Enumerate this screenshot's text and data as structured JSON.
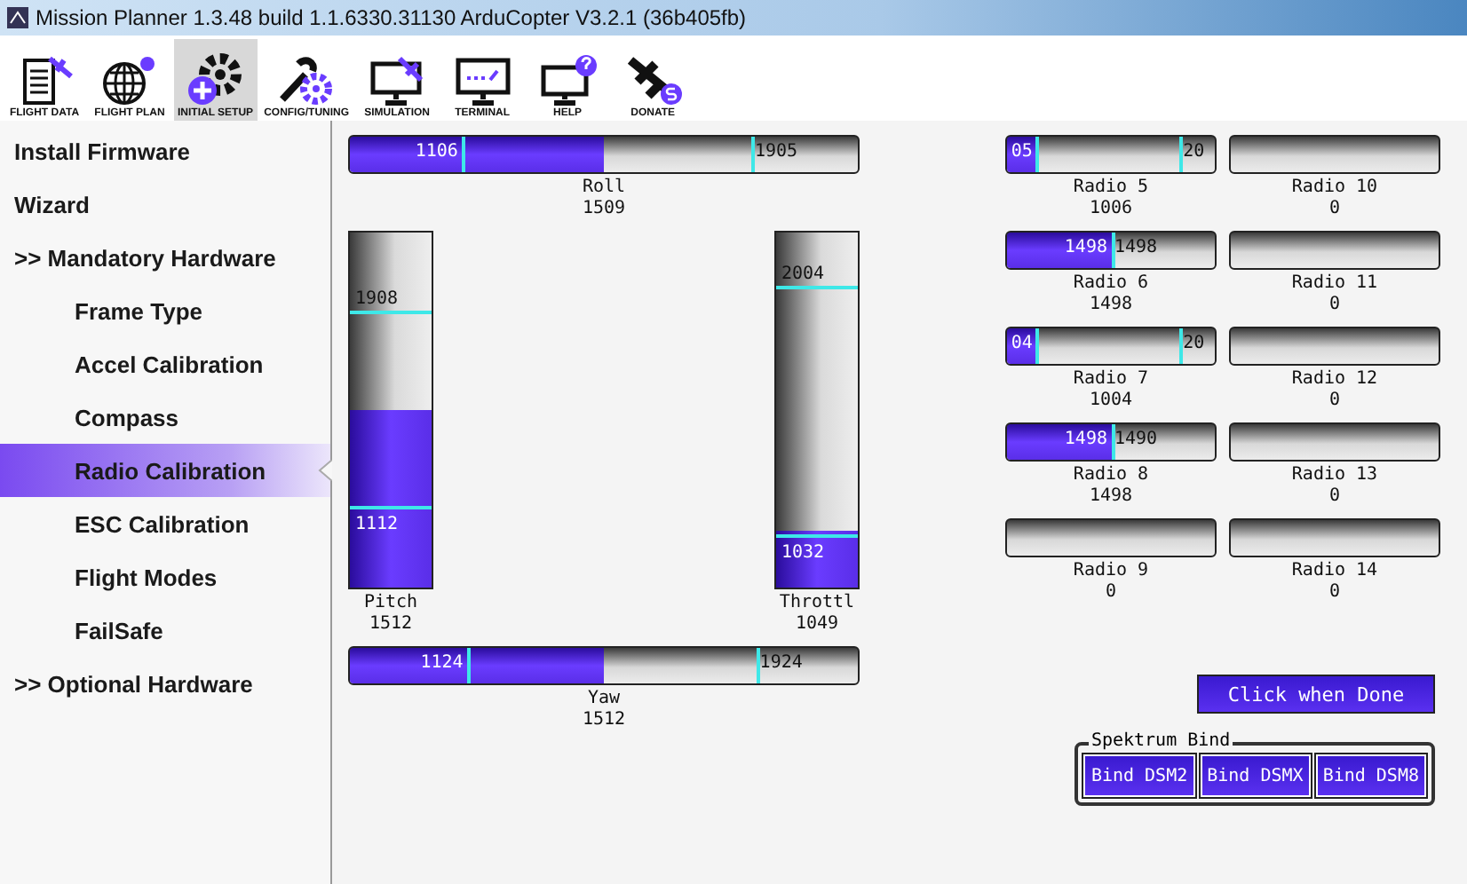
{
  "window": {
    "title": "Mission Planner 1.3.48 build 1.1.6330.31130 ArduCopter V3.2.1 (36b405fb)"
  },
  "toolbar": [
    {
      "label": "FLIGHT DATA",
      "selected": false
    },
    {
      "label": "FLIGHT PLAN",
      "selected": false
    },
    {
      "label": "INITIAL SETUP",
      "selected": true
    },
    {
      "label": "CONFIG/TUNING",
      "selected": false
    },
    {
      "label": "SIMULATION",
      "selected": false
    },
    {
      "label": "TERMINAL",
      "selected": false
    },
    {
      "label": "HELP",
      "selected": false
    },
    {
      "label": "DONATE",
      "selected": false
    }
  ],
  "sidebar": {
    "items": [
      {
        "label": "Install Firmware",
        "selected": false
      },
      {
        "label": "Wizard",
        "selected": false
      },
      {
        "label": ">> Mandatory Hardware",
        "selected": false,
        "children": [
          {
            "label": "Frame Type",
            "selected": false
          },
          {
            "label": "Accel Calibration",
            "selected": false
          },
          {
            "label": "Compass",
            "selected": false
          },
          {
            "label": "Radio Calibration",
            "selected": true
          },
          {
            "label": "ESC Calibration",
            "selected": false
          },
          {
            "label": "Flight Modes",
            "selected": false
          },
          {
            "label": "FailSafe",
            "selected": false
          }
        ]
      },
      {
        "label": ">> Optional Hardware",
        "selected": false
      }
    ]
  },
  "sticks": {
    "roll": {
      "name": "Roll",
      "value": "1509",
      "level": 0.5,
      "min": {
        "text": "1106",
        "level": 0.22
      },
      "max": {
        "text": "1905",
        "level": 0.79
      }
    },
    "pitch": {
      "name": "Pitch",
      "value": "1512",
      "level": 0.5,
      "min": {
        "text": "1112",
        "level": 0.22
      },
      "max": {
        "text": "1908",
        "level": 0.77
      }
    },
    "throttle": {
      "name": "Throttl",
      "value": "1049",
      "level": 0.16,
      "min": {
        "text": "1032",
        "level": 0.14
      },
      "max": {
        "text": "2004",
        "level": 0.84
      }
    },
    "yaw": {
      "name": "Yaw",
      "value": "1512",
      "level": 0.5,
      "min": {
        "text": "1124",
        "level": 0.23
      },
      "max": {
        "text": "1924",
        "level": 0.8
      }
    }
  },
  "radios": [
    {
      "name": "Radio 5",
      "value": "1006",
      "level": 0.14,
      "min": {
        "text": "05",
        "level": 0.14
      },
      "max": {
        "text": "20",
        "level": 0.83
      }
    },
    {
      "name": "Radio 10",
      "value": "0"
    },
    {
      "name": "Radio 6",
      "value": "1498",
      "level": 0.5,
      "min": {
        "text": "1498",
        "level": 0.5
      },
      "max": {
        "text": "1498"
      }
    },
    {
      "name": "Radio 11",
      "value": "0"
    },
    {
      "name": "Radio 7",
      "value": "1004",
      "level": 0.14,
      "min": {
        "text": "04",
        "level": 0.14
      },
      "max": {
        "text": "20",
        "level": 0.83
      }
    },
    {
      "name": "Radio 12",
      "value": "0"
    },
    {
      "name": "Radio 8",
      "value": "1498",
      "level": 0.5,
      "min": {
        "text": "1498",
        "level": 0.5
      },
      "max": {
        "text": "1490"
      }
    },
    {
      "name": "Radio 13",
      "value": "0"
    },
    {
      "name": "Radio 9",
      "value": "0"
    },
    {
      "name": "Radio 14",
      "value": "0"
    }
  ],
  "done_button": "Click when Done",
  "spektrum": {
    "title": "Spektrum Bind",
    "buttons": [
      "Bind DSM2",
      "Bind DSMX",
      "Bind DSM8"
    ]
  }
}
